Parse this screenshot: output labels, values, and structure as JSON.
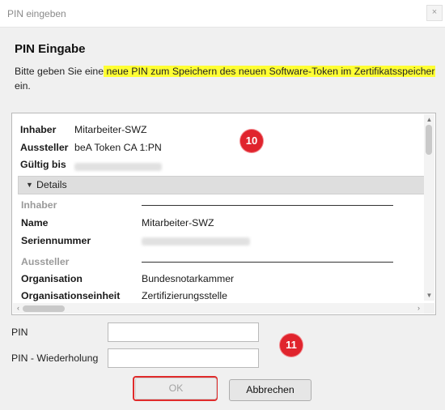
{
  "window": {
    "title": "PIN eingeben",
    "close_glyph": "×"
  },
  "header": {
    "heading": "PIN Eingabe",
    "desc_pre": "Bitte geben Sie eine",
    "desc_highlight": " neue PIN zum Speichern des neuen Software-Token im Zertifikatsspeicher",
    "desc_post": "ein."
  },
  "cert": {
    "inhaber_label": "Inhaber",
    "inhaber_value": "Mitarbeiter-SWZ",
    "aussteller_label": "Aussteller",
    "aussteller_value": "beA Token CA 1:PN",
    "gueltig_label": "Gültig bis"
  },
  "details": {
    "toggle_label": "Details",
    "section_inhaber": "Inhaber",
    "name_label": "Name",
    "name_value": "Mitarbeiter-SWZ",
    "serial_label": "Seriennummer",
    "section_aussteller": "Aussteller",
    "org_label": "Organisation",
    "org_value": "Bundesnotarkammer",
    "orgunit_label": "Organisationseinheit",
    "orgunit_value": "Zertifizierungsstelle"
  },
  "annotations": {
    "badge_10": "10",
    "badge_11": "11"
  },
  "form": {
    "pin_label": "PIN",
    "pin_value": "",
    "pin_repeat_label": "PIN - Wiederholung",
    "pin_repeat_value": ""
  },
  "buttons": {
    "ok": "OK",
    "cancel": "Abbrechen"
  },
  "colors": {
    "highlight": "#ffff33",
    "badge": "#e0242d",
    "ok_frame": "#e02b2b"
  }
}
